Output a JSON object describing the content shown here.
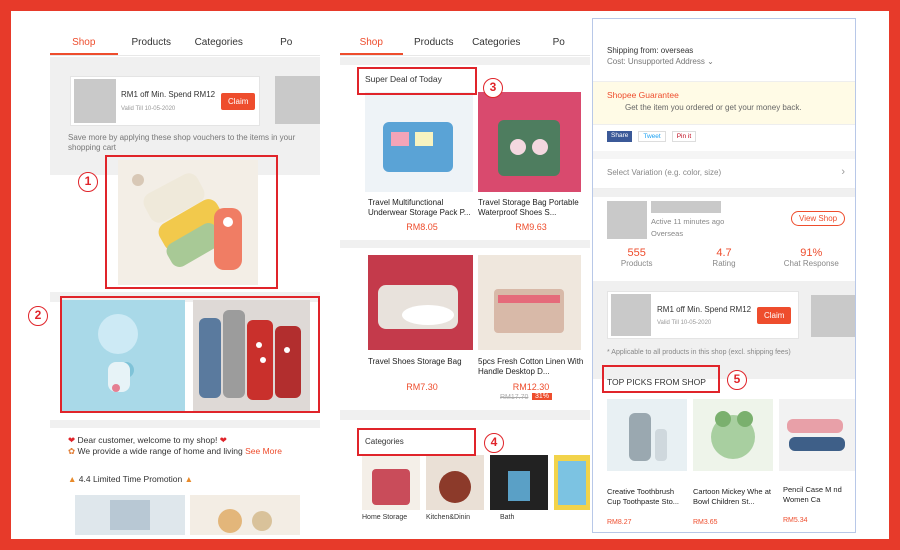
{
  "colors": {
    "accent": "#ee4d2d",
    "frame": "#e73a2a",
    "annotation": "#e0242a"
  },
  "left": {
    "tabs": [
      "Shop",
      "Products",
      "Categories",
      "Po"
    ],
    "voucher": {
      "title": "RM1 off Min. Spend RM12",
      "valid": "Valid Till 10-05-2020",
      "claim": "Claim"
    },
    "voucher_note": "Save more by applying these shop vouchers to the items in your shopping cart",
    "welcome": "Dear customer, welcome to my shop!",
    "welcome2": "We provide a wide range of home and living",
    "see_more": "See More",
    "promo": "4.4 Limited Time Promotion",
    "badges": [
      "1",
      "2"
    ]
  },
  "middle": {
    "tabs": [
      "Shop",
      "Products",
      "Categories",
      "Po"
    ],
    "super_deal": "Super Deal of Today",
    "products": [
      {
        "title": "Travel Multifunctional Underwear Storage Pack P...",
        "price": "RM8.05"
      },
      {
        "title": "Travel Storage Bag Portable Waterproof Shoes S...",
        "price": "RM9.63"
      },
      {
        "title": "Travel Shoes Storage Bag",
        "price": "RM7.30"
      },
      {
        "title": "5pcs Fresh Cotton Linen With Handle Desktop D...",
        "price": "RM12.30",
        "old_price": "RM17.70",
        "discount": "31%"
      }
    ],
    "categories_label": "Categories",
    "categories": [
      "Home Storage",
      "Kitchen&Dinin",
      "Bath"
    ],
    "badges": [
      "3",
      "4"
    ]
  },
  "right": {
    "shipping_from": "Shipping from: overseas",
    "cost": "Cost: Unsupported Address",
    "guarantee_title": "Shopee Guarantee",
    "guarantee_text": "Get the item you ordered or get your money back.",
    "share": [
      "Share",
      "Tweet",
      "Pin it"
    ],
    "variation": "Select Variation (e.g. color, size)",
    "active": "Active 11 minutes ago",
    "location": "Overseas",
    "view_shop": "View Shop",
    "stats": [
      {
        "value": "555",
        "label": "Products"
      },
      {
        "value": "4.7",
        "label": "Rating"
      },
      {
        "value": "91%",
        "label": "Chat Response"
      }
    ],
    "voucher": {
      "title": "RM1 off Min. Spend RM12",
      "valid": "Valid Till 10-05-2020",
      "claim": "Claim"
    },
    "applicable": "* Applicable to all products in this shop (excl. shipping fees)",
    "top_picks": "TOP PICKS FROM SHOP",
    "picks": [
      {
        "title": "Creative Toothbrush Cup Toothpaste Sto...",
        "price": "RM8.27"
      },
      {
        "title": "Cartoon Mickey Whe at Bowl Children St...",
        "price": "RM3.65"
      },
      {
        "title": "Pencil Case M nd Women Ca",
        "price": "RM5.34"
      }
    ],
    "badge": "5"
  }
}
